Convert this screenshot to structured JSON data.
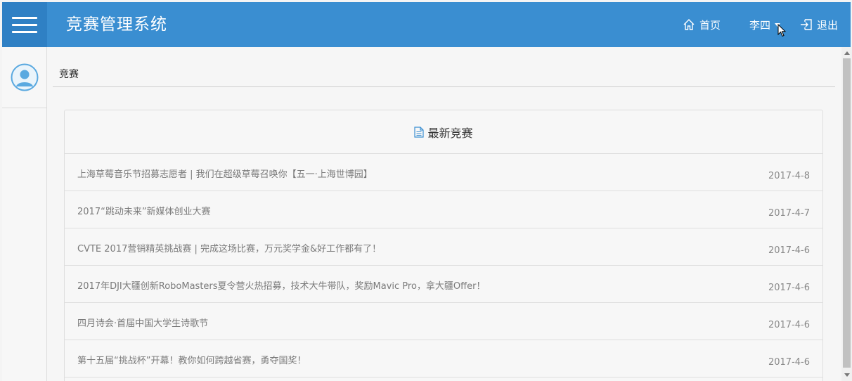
{
  "header": {
    "app_title": "竞赛管理系统",
    "home_label": "首页",
    "user_name": "李四",
    "logout_label": "退出"
  },
  "breadcrumb": {
    "label": "竞赛"
  },
  "panel": {
    "title": "最新竞赛",
    "items": [
      {
        "title": "上海草莓音乐节招募志愿者 | 我们在超级草莓召唤你【五一·上海世博园】",
        "date": "2017-4-8"
      },
      {
        "title": "2017“跳动未来”新媒体创业大赛",
        "date": "2017-4-7"
      },
      {
        "title": "CVTE 2017营销精英挑战赛 | 完成这场比赛，万元奖学金&好工作都有了！",
        "date": "2017-4-6"
      },
      {
        "title": "2017年DJI大疆创新RoboMasters夏令营火热招募，技术大牛带队，奖励Mavic Pro，拿大疆Offer！",
        "date": "2017-4-6"
      },
      {
        "title": "四月诗会·首届中国大学生诗歌节",
        "date": "2017-4-6"
      },
      {
        "title": "第十五届“挑战杯”开幕！教你如何跨越省赛，勇夺国奖！",
        "date": "2017-4-6"
      }
    ]
  },
  "colors": {
    "header_bg": "#3a8ed1",
    "menu_bg": "#2f80c4",
    "avatar": "#5aa9e0"
  },
  "icons": [
    "menu-icon",
    "home-icon",
    "logout-icon",
    "user-avatar-icon",
    "document-icon",
    "mouse-cursor-icon"
  ]
}
